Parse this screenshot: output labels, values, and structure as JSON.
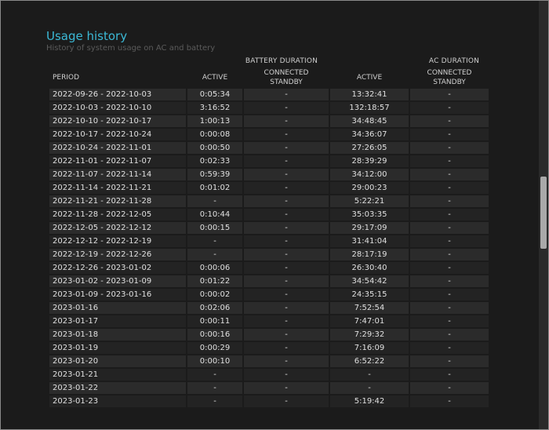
{
  "report": {
    "title": "Usage history",
    "subtitle": "History of system usage on AC and battery"
  },
  "groups": {
    "battery": "BATTERY DURATION",
    "ac": "AC DURATION"
  },
  "columns": {
    "period": "PERIOD",
    "battery_active": "ACTIVE",
    "battery_standby": "CONNECTED STANDBY",
    "ac_active": "ACTIVE",
    "ac_standby": "CONNECTED STANDBY"
  },
  "rows": [
    {
      "period": "2022-09-26 - 2022-10-03",
      "battery_active": "0:05:34",
      "battery_standby": "-",
      "ac_active": "13:32:41",
      "ac_standby": "-"
    },
    {
      "period": "2022-10-03 - 2022-10-10",
      "battery_active": "3:16:52",
      "battery_standby": "-",
      "ac_active": "132:18:57",
      "ac_standby": "-"
    },
    {
      "period": "2022-10-10 - 2022-10-17",
      "battery_active": "1:00:13",
      "battery_standby": "-",
      "ac_active": "34:48:45",
      "ac_standby": "-"
    },
    {
      "period": "2022-10-17 - 2022-10-24",
      "battery_active": "0:00:08",
      "battery_standby": "-",
      "ac_active": "34:36:07",
      "ac_standby": "-"
    },
    {
      "period": "2022-10-24 - 2022-11-01",
      "battery_active": "0:00:50",
      "battery_standby": "-",
      "ac_active": "27:26:05",
      "ac_standby": "-"
    },
    {
      "period": "2022-11-01 - 2022-11-07",
      "battery_active": "0:02:33",
      "battery_standby": "-",
      "ac_active": "28:39:29",
      "ac_standby": "-"
    },
    {
      "period": "2022-11-07 - 2022-11-14",
      "battery_active": "0:59:39",
      "battery_standby": "-",
      "ac_active": "34:12:00",
      "ac_standby": "-"
    },
    {
      "period": "2022-11-14 - 2022-11-21",
      "battery_active": "0:01:02",
      "battery_standby": "-",
      "ac_active": "29:00:23",
      "ac_standby": "-"
    },
    {
      "period": "2022-11-21 - 2022-11-28",
      "battery_active": "-",
      "battery_standby": "-",
      "ac_active": "5:22:21",
      "ac_standby": "-"
    },
    {
      "period": "2022-11-28 - 2022-12-05",
      "battery_active": "0:10:44",
      "battery_standby": "-",
      "ac_active": "35:03:35",
      "ac_standby": "-"
    },
    {
      "period": "2022-12-05 - 2022-12-12",
      "battery_active": "0:00:15",
      "battery_standby": "-",
      "ac_active": "29:17:09",
      "ac_standby": "-"
    },
    {
      "period": "2022-12-12 - 2022-12-19",
      "battery_active": "-",
      "battery_standby": "-",
      "ac_active": "31:41:04",
      "ac_standby": "-"
    },
    {
      "period": "2022-12-19 - 2022-12-26",
      "battery_active": "-",
      "battery_standby": "-",
      "ac_active": "28:17:19",
      "ac_standby": "-"
    },
    {
      "period": "2022-12-26 - 2023-01-02",
      "battery_active": "0:00:06",
      "battery_standby": "-",
      "ac_active": "26:30:40",
      "ac_standby": "-"
    },
    {
      "period": "2023-01-02 - 2023-01-09",
      "battery_active": "0:01:22",
      "battery_standby": "-",
      "ac_active": "34:54:42",
      "ac_standby": "-"
    },
    {
      "period": "2023-01-09 - 2023-01-16",
      "battery_active": "0:00:02",
      "battery_standby": "-",
      "ac_active": "24:35:15",
      "ac_standby": "-"
    },
    {
      "period": "2023-01-16",
      "battery_active": "0:02:06",
      "battery_standby": "-",
      "ac_active": "7:52:54",
      "ac_standby": "-"
    },
    {
      "period": "2023-01-17",
      "battery_active": "0:00:11",
      "battery_standby": "-",
      "ac_active": "7:47:01",
      "ac_standby": "-"
    },
    {
      "period": "2023-01-18",
      "battery_active": "0:00:16",
      "battery_standby": "-",
      "ac_active": "7:29:32",
      "ac_standby": "-"
    },
    {
      "period": "2023-01-19",
      "battery_active": "0:00:29",
      "battery_standby": "-",
      "ac_active": "7:16:09",
      "ac_standby": "-"
    },
    {
      "period": "2023-01-20",
      "battery_active": "0:00:10",
      "battery_standby": "-",
      "ac_active": "6:52:22",
      "ac_standby": "-"
    },
    {
      "period": "2023-01-21",
      "battery_active": "-",
      "battery_standby": "-",
      "ac_active": "-",
      "ac_standby": "-"
    },
    {
      "period": "2023-01-22",
      "battery_active": "-",
      "battery_standby": "-",
      "ac_active": "-",
      "ac_standby": "-"
    },
    {
      "period": "2023-01-23",
      "battery_active": "-",
      "battery_standby": "-",
      "ac_active": "5:19:42",
      "ac_standby": "-"
    }
  ]
}
